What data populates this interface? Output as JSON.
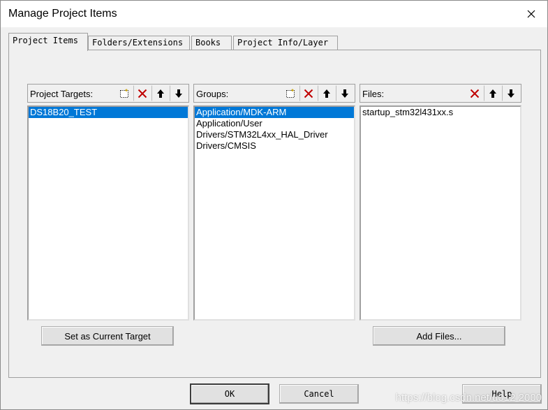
{
  "window": {
    "title": "Manage Project Items"
  },
  "tabs": [
    {
      "label": "Project Items",
      "active": true
    },
    {
      "label": "Folders/Extensions",
      "active": false
    },
    {
      "label": "Books",
      "active": false
    },
    {
      "label": "Project Info/Layer",
      "active": false
    }
  ],
  "targets": {
    "label": "Project Targets:",
    "items": [
      "DS18B20_TEST"
    ],
    "selected": 0,
    "set_current_label": "Set as Current Target"
  },
  "groups": {
    "label": "Groups:",
    "items": [
      "Application/MDK-ARM",
      "Application/User",
      "Drivers/STM32L4xx_HAL_Driver",
      "Drivers/CMSIS"
    ],
    "selected": 0
  },
  "files": {
    "label": "Files:",
    "items": [
      "startup_stm32l431xx.s"
    ],
    "add_files_label": "Add Files..."
  },
  "buttons": {
    "ok": "OK",
    "cancel": "Cancel",
    "help": "Help"
  },
  "watermark": "https://blog.csdn.net/u012 2000",
  "colors": {
    "selection": "#0078d7",
    "delete_icon": "#c00000"
  },
  "icons": {
    "new": "new-item-icon",
    "delete": "delete-icon",
    "up": "arrow-up-icon",
    "down": "arrow-down-icon"
  }
}
